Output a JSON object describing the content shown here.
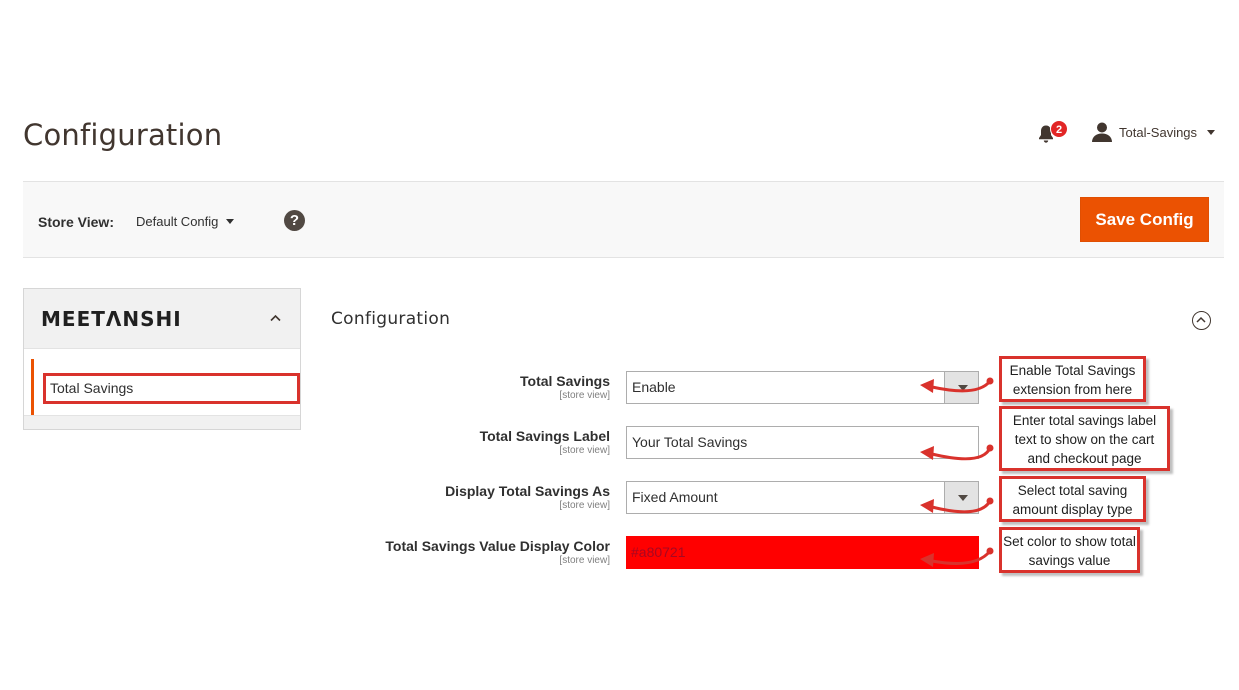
{
  "header": {
    "page_title": "Configuration",
    "notifications_count": "2",
    "user_name": "Total-Savings"
  },
  "store_bar": {
    "store_view_label": "Store View:",
    "store_view_value": "Default Config",
    "help_symbol": "?",
    "save_label": "Save Config"
  },
  "sidebar": {
    "brand": "MEETΛNSHI",
    "items": [
      {
        "label": "Total Savings"
      }
    ]
  },
  "section": {
    "title": "Configuration"
  },
  "fields": [
    {
      "label": "Total Savings",
      "scope": "[store view]",
      "value": "Enable",
      "type": "select"
    },
    {
      "label": "Total Savings Label",
      "scope": "[store view]",
      "value": "Your Total Savings",
      "type": "text"
    },
    {
      "label": "Display Total Savings As",
      "scope": "[store view]",
      "value": "Fixed Amount",
      "type": "select"
    },
    {
      "label": "Total Savings Value Display Color",
      "scope": "[store view]",
      "value": "#a80721",
      "type": "color"
    }
  ],
  "callouts": [
    {
      "text": "Enable Total Savings extension from here"
    },
    {
      "text": "Enter total savings label text to show on the cart and checkout page"
    },
    {
      "text": "Select total saving amount display type"
    },
    {
      "text": "Set color to show total savings value"
    }
  ],
  "colors": {
    "accent": "#eb5202",
    "callout_border": "#d9322c",
    "color_field_bg": "#ff0000",
    "color_field_text": "#a80721"
  },
  "icons": {
    "notifications": "bell-icon",
    "user": "user-icon",
    "help": "help-icon",
    "sidebar_toggle": "chevron-up-icon",
    "section_toggle": "chevron-up-circle-icon"
  }
}
